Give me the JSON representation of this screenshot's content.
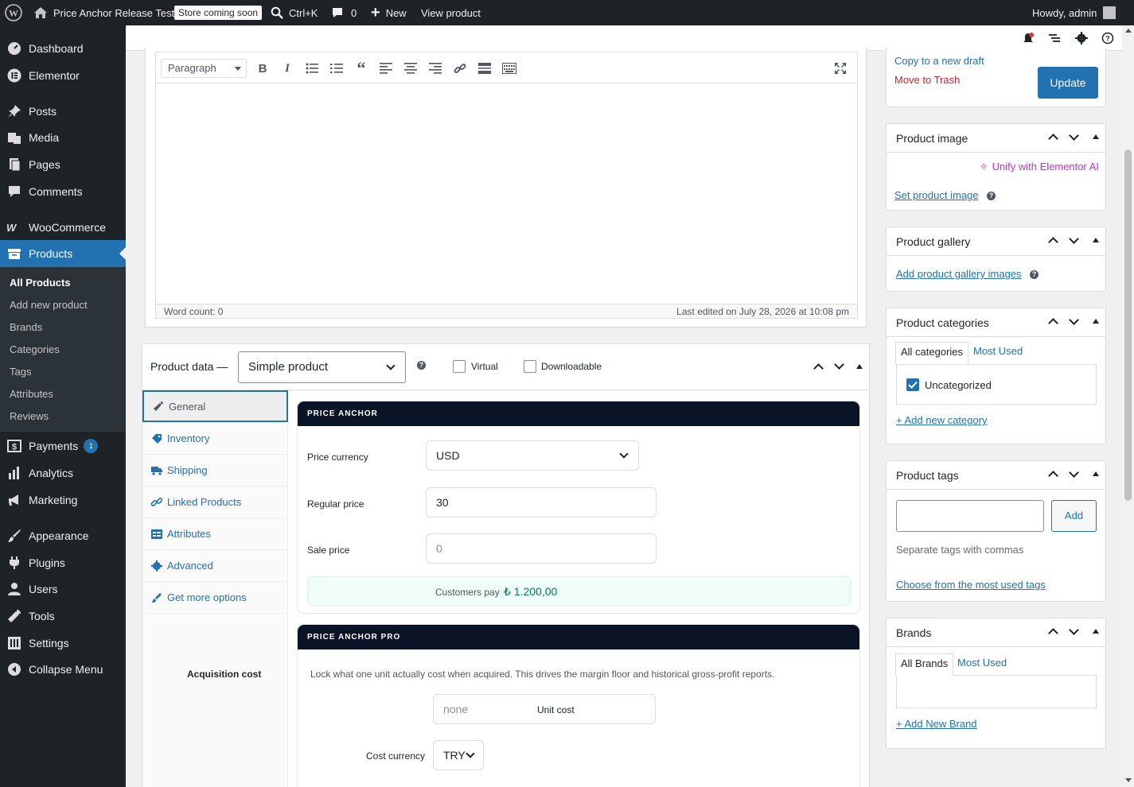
{
  "admin_bar": {
    "site_name": "Price Anchor Release Test",
    "store_badge": "Store coming soon",
    "search_shortcut": "Ctrl+K",
    "comments_count": "0",
    "new_label": "New",
    "view_label": "View product",
    "howdy": "Howdy, admin"
  },
  "sidebar": {
    "items": [
      {
        "label": "Dashboard",
        "icon": "dashboard-icon"
      },
      {
        "label": "Elementor",
        "icon": "elementor-icon"
      },
      {
        "label": "Posts",
        "icon": "pin-icon"
      },
      {
        "label": "Media",
        "icon": "media-icon"
      },
      {
        "label": "Pages",
        "icon": "pages-icon"
      },
      {
        "label": "Comments",
        "icon": "comment-icon"
      },
      {
        "label": "WooCommerce",
        "icon": "woo-icon"
      },
      {
        "label": "Products",
        "icon": "archive-icon"
      },
      {
        "label": "Payments",
        "icon": "dollar-icon",
        "badge": "1"
      },
      {
        "label": "Analytics",
        "icon": "chart-icon"
      },
      {
        "label": "Marketing",
        "icon": "megaphone-icon"
      },
      {
        "label": "Appearance",
        "icon": "brush-icon"
      },
      {
        "label": "Plugins",
        "icon": "plugin-icon"
      },
      {
        "label": "Users",
        "icon": "user-icon"
      },
      {
        "label": "Tools",
        "icon": "wrench-icon"
      },
      {
        "label": "Settings",
        "icon": "settings-icon"
      },
      {
        "label": "Collapse Menu",
        "icon": "collapse-icon"
      }
    ],
    "submenu": [
      "All Products",
      "Add new product",
      "Brands",
      "Categories",
      "Tags",
      "Attributes",
      "Reviews"
    ]
  },
  "editor": {
    "format": "Paragraph",
    "word_count": "Word count: 0",
    "last_edited": "Last edited on July 28, 2026 at 10:08 pm"
  },
  "product_data": {
    "label": "Product data —",
    "type": "Simple product",
    "virtual_label": "Virtual",
    "downloadable_label": "Downloadable",
    "tabs": [
      "General",
      "Inventory",
      "Shipping",
      "Linked Products",
      "Attributes",
      "Advanced",
      "Get more options"
    ],
    "acquisition_label": "Acquisition cost"
  },
  "price_anchor": {
    "title": "PRICE ANCHOR",
    "currency_label": "Price currency",
    "currency_value": "USD",
    "regular_label": "Regular price",
    "regular_value": "30",
    "sale_label": "Sale price",
    "sale_placeholder": "0",
    "customers_pay_label": "Customers pay",
    "customers_pay_value": "₺ 1.200,00"
  },
  "price_anchor_pro": {
    "title": "PRICE ANCHOR PRO",
    "description": "Lock what one unit actually cost when acquired. This drives the margin floor and historical gross-profit reports.",
    "unit_cost_placeholder": "none",
    "unit_cost_label": "Unit cost",
    "cost_currency_label": "Cost currency",
    "cost_currency_value": "TRY"
  },
  "publish": {
    "copy_draft": "Copy to a new draft",
    "trash": "Move to Trash",
    "update": "Update"
  },
  "product_image": {
    "title": "Product image",
    "unify": "Unify with Elementor AI",
    "set": "Set product image"
  },
  "product_gallery": {
    "title": "Product gallery",
    "add": "Add product gallery images"
  },
  "product_categories": {
    "title": "Product categories",
    "tab_all": "All categories",
    "tab_used": "Most Used",
    "item": "Uncategorized",
    "add": "+ Add new category"
  },
  "product_tags": {
    "title": "Product tags",
    "add_button": "Add",
    "hint": "Separate tags with commas",
    "choose": "Choose from the most used tags"
  },
  "brands": {
    "title": "Brands",
    "tab_all": "All Brands",
    "tab_used": "Most Used",
    "add": "+ Add New Brand"
  },
  "colors": {
    "accent": "#2271b1",
    "admin_dark": "#1d2327",
    "trash_red": "#b32d2e",
    "elementor_pink": "#c22fd3",
    "anchor_header": "#0b1426",
    "pay_green": "#047857"
  }
}
